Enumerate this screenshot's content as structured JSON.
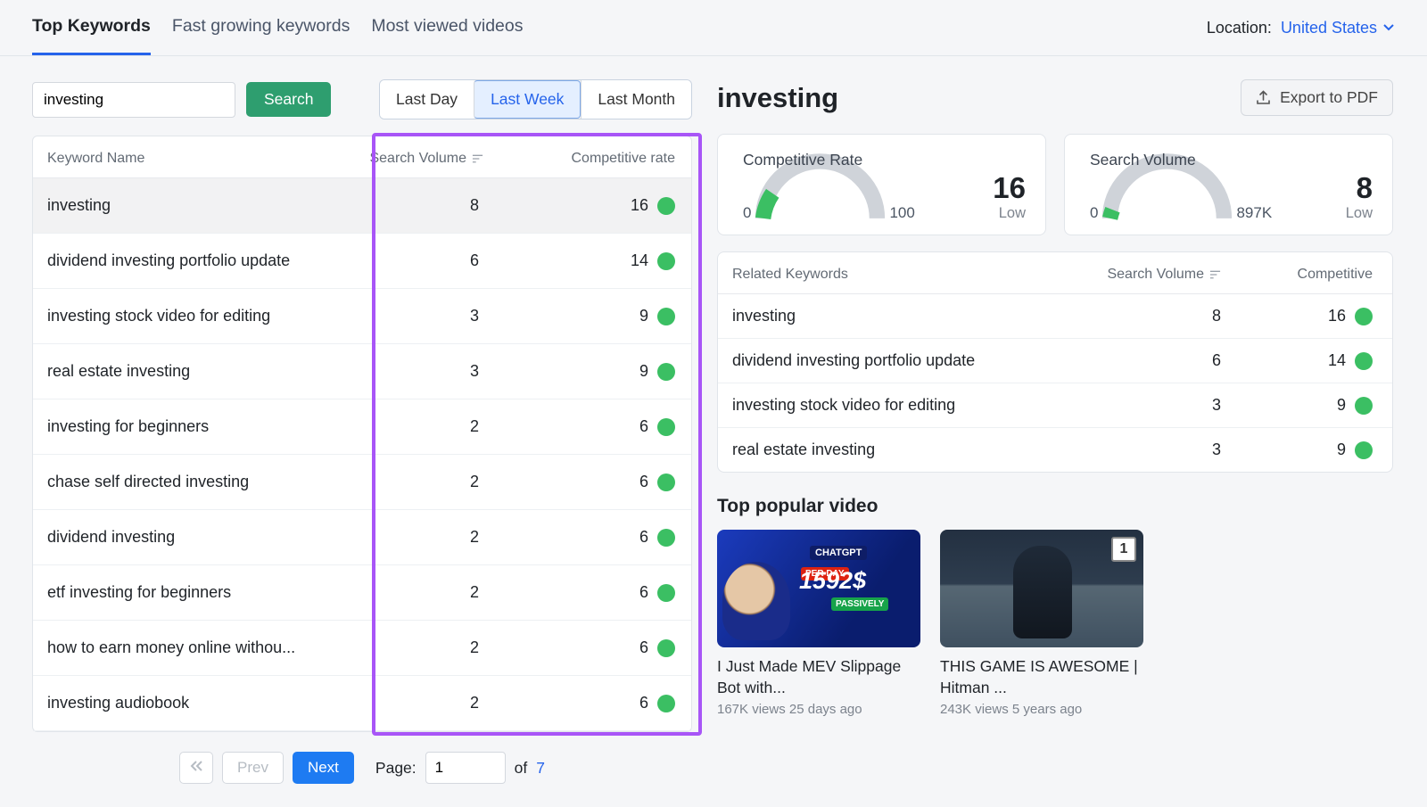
{
  "tabs": [
    "Top Keywords",
    "Fast growing keywords",
    "Most viewed videos"
  ],
  "activeTab": 0,
  "location": {
    "label": "Location:",
    "value": "United States"
  },
  "search": {
    "value": "investing",
    "button": "Search"
  },
  "range": {
    "options": [
      "Last Day",
      "Last Week",
      "Last Month"
    ],
    "active": 1
  },
  "table": {
    "headers": {
      "name": "Keyword Name",
      "sv": "Search Volume",
      "comp": "Competitive rate"
    },
    "rows": [
      {
        "name": "investing",
        "sv": 8,
        "comp": 16,
        "selected": true
      },
      {
        "name": "dividend investing portfolio update",
        "sv": 6,
        "comp": 14
      },
      {
        "name": "investing stock video for editing",
        "sv": 3,
        "comp": 9
      },
      {
        "name": "real estate investing",
        "sv": 3,
        "comp": 9
      },
      {
        "name": "investing for beginners",
        "sv": 2,
        "comp": 6
      },
      {
        "name": "chase self directed investing",
        "sv": 2,
        "comp": 6
      },
      {
        "name": "dividend investing",
        "sv": 2,
        "comp": 6
      },
      {
        "name": "etf investing for beginners",
        "sv": 2,
        "comp": 6
      },
      {
        "name": "how to earn money online withou...",
        "sv": 2,
        "comp": 6
      },
      {
        "name": "investing audiobook",
        "sv": 2,
        "comp": 6
      }
    ]
  },
  "pager": {
    "prev": "Prev",
    "next": "Next",
    "pageLabel": "Page:",
    "page": "1",
    "ofLabel": "of",
    "total": "7"
  },
  "detail": {
    "title": "investing",
    "export": "Export to PDF",
    "comp": {
      "label": "Competitive Rate",
      "min": "0",
      "max": "100",
      "value": "16",
      "level": "Low",
      "fillPct": 16
    },
    "sv": {
      "label": "Search Volume",
      "min": "0",
      "max": "897K",
      "value": "8",
      "level": "Low",
      "fillPct": 3
    }
  },
  "related": {
    "headers": {
      "name": "Related Keywords",
      "sv": "Search Volume",
      "comp": "Competitive"
    },
    "rows": [
      {
        "name": "investing",
        "sv": 8,
        "comp": 16
      },
      {
        "name": "dividend investing portfolio update",
        "sv": 6,
        "comp": 14
      },
      {
        "name": "investing stock video for editing",
        "sv": 3,
        "comp": 9
      },
      {
        "name": "real estate investing",
        "sv": 3,
        "comp": 9
      }
    ]
  },
  "videosTitle": "Top popular video",
  "videos": [
    {
      "title": "I Just Made MEV Slippage Bot with...",
      "meta": "167K views 25 days ago"
    },
    {
      "title": "THIS GAME IS AWESOME | Hitman ...",
      "meta": "243K views 5 years ago"
    }
  ]
}
